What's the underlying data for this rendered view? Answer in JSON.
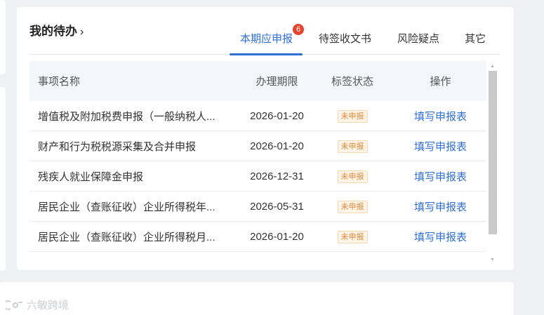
{
  "card": {
    "title": "我的待办",
    "title_chevron": "›"
  },
  "tabs": [
    {
      "label": "本期应申报",
      "badge": "6",
      "active": true
    },
    {
      "label": "待签收文书",
      "active": false
    },
    {
      "label": "风险疑点",
      "active": false
    },
    {
      "label": "其它",
      "active": false
    }
  ],
  "table": {
    "headers": [
      "事项名称",
      "办理期限",
      "标签状态",
      "操作"
    ],
    "rows": [
      {
        "name": "增值税及附加税费申报（一般纳税人...",
        "deadline": "2026-01-20",
        "status": "未申报",
        "action": "填写申报表"
      },
      {
        "name": "财产和行为税税源采集及合并申报",
        "deadline": "2026-01-20",
        "status": "未申报",
        "action": "填写申报表"
      },
      {
        "name": "残疾人就业保障金申报",
        "deadline": "2026-12-31",
        "status": "未申报",
        "action": "填写申报表"
      },
      {
        "name": "居民企业（查账征收）企业所得税年...",
        "deadline": "2026-05-31",
        "status": "未申报",
        "action": "填写申报表"
      },
      {
        "name": "居民企业（查账征收）企业所得税月...",
        "deadline": "2026-01-20",
        "status": "未申报",
        "action": "填写申报表"
      },
      {
        "name": "",
        "deadline": "",
        "status": "",
        "action": ""
      }
    ]
  },
  "watermark": {
    "text": "六敏跨境"
  },
  "colors": {
    "accent": "#2f6fd6",
    "badge": "#e8432c",
    "tag_text": "#e0893c",
    "tag_bg": "#fff4e5"
  }
}
